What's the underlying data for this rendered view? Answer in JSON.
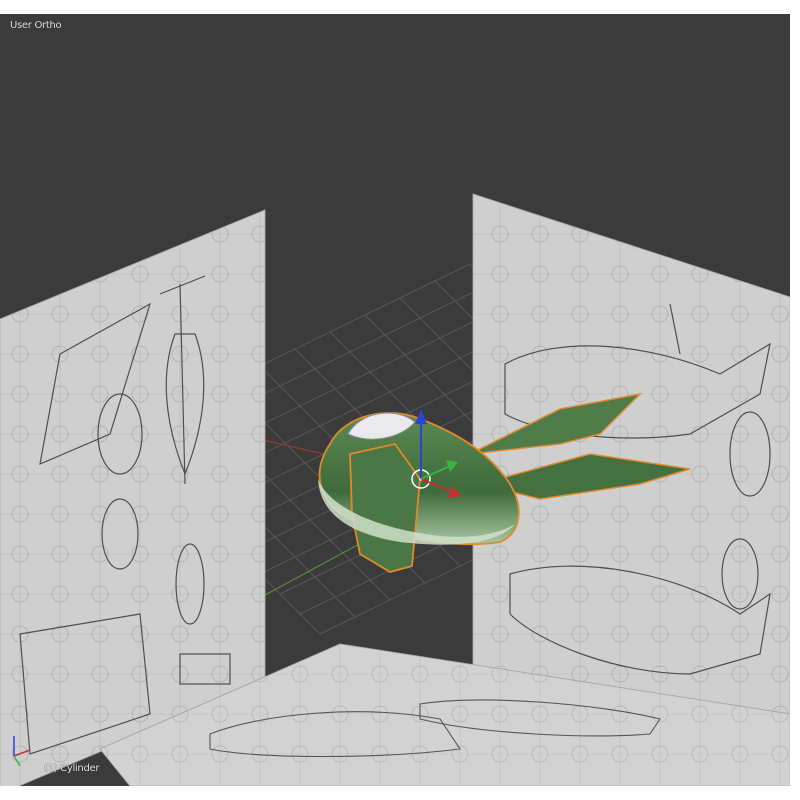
{
  "viewport": {
    "view_name": "User Ortho",
    "active_object": "(1) Cylinder"
  },
  "colors": {
    "background": "#3b3b3b",
    "grid": "#565656",
    "x_axis": "#b03a3a",
    "y_axis": "#5f9a3a",
    "model_body": "#4d7a48",
    "model_highlight": "#8fb58a",
    "selection_outline": "#e08a2a",
    "reference_plane": "#cfcfcf"
  },
  "icons": {
    "transform_gizmo": "translate-manipulator",
    "axis_indicator": "view-axis-widget"
  }
}
